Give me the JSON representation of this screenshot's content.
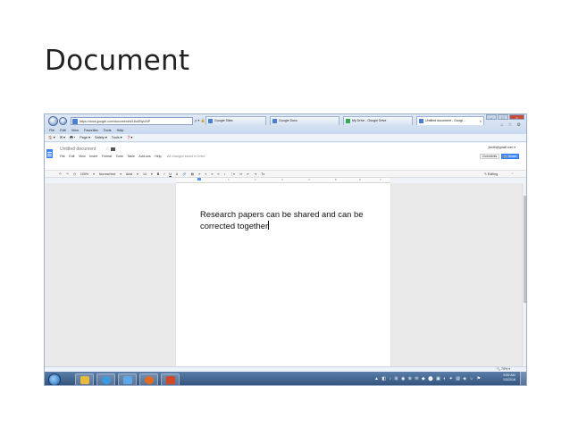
{
  "slide": {
    "title": "Document"
  },
  "browser": {
    "url": "https://docs.google.com/document/d/18uDByUNP",
    "addr_tools": "ρ ▾ 🔒 C",
    "tabs": [
      {
        "label": "Google Sites",
        "icon": "google-sites-icon"
      },
      {
        "label": "Google Docs",
        "icon": "google-docs-icon"
      },
      {
        "label": "My Drive - Google Drive",
        "icon": "google-drive-icon"
      },
      {
        "label": "Untitled document - Googl...",
        "icon": "google-docs-icon",
        "active": true
      }
    ],
    "close_tab": "×",
    "window_buttons": [
      "–",
      "□",
      "×"
    ],
    "chrome_icons": "⌂ ☆ ⚙",
    "menu": [
      "File",
      "Edit",
      "View",
      "Favorites",
      "Tools",
      "Help"
    ],
    "command_bar": [
      "🏠 ▾",
      "✉ ▾",
      "🖶 ▾",
      "Page ▾",
      "Safety ▾",
      "Tools ▾",
      "❓▾"
    ]
  },
  "docs": {
    "title": "Untitled document",
    "star": "☆",
    "menu": [
      "File",
      "Edit",
      "View",
      "Insert",
      "Format",
      "Tools",
      "Table",
      "Add-ons",
      "Help"
    ],
    "save_status": "All changes saved in Drive",
    "user_email": "jsmith@gmail.com ▾",
    "comments_label": "Comments",
    "share_label": "🔒 Share",
    "toolbar": [
      "↶",
      "↷",
      "⎙",
      "100%",
      "▾",
      "Normal text",
      "▾",
      "Arial",
      "▾",
      "14",
      "▾",
      "B",
      "I",
      "U",
      "A",
      "🔗",
      "▤",
      "≡",
      "≡",
      "≡",
      "≡",
      "↕",
      "⋮≡",
      "⁝≡",
      "⇤",
      "⇥",
      "Tx"
    ],
    "editing_label": "✎ Editing",
    "toolbar_collapse": "⌃",
    "ruler_numbers": [
      "1",
      "2",
      "3",
      "4",
      "5",
      "6",
      "7"
    ],
    "body_text": "Research papers can be shared and can be corrected together"
  },
  "status": {
    "zoom": "🔍 75% ▾"
  },
  "taskbar": {
    "apps": [
      {
        "icon": "file-explorer-icon",
        "color": "#e8b93c"
      },
      {
        "icon": "internet-explorer-icon",
        "color": "#3b9ae1"
      },
      {
        "icon": "desktop-app-icon",
        "color": "#5fa8e8"
      },
      {
        "icon": "firefox-icon",
        "color": "#e66a1f"
      },
      {
        "icon": "powerpoint-icon",
        "color": "#d24726"
      }
    ],
    "tray_icons": "▲ ◧ ♪ ⊞ ◉ ⊗ ✉ ◆ ⬤ ▣ ◐ ✦ ▤ ◈ ☼ ⚑",
    "time": "9:59 AM",
    "date": "1/3/2016"
  }
}
